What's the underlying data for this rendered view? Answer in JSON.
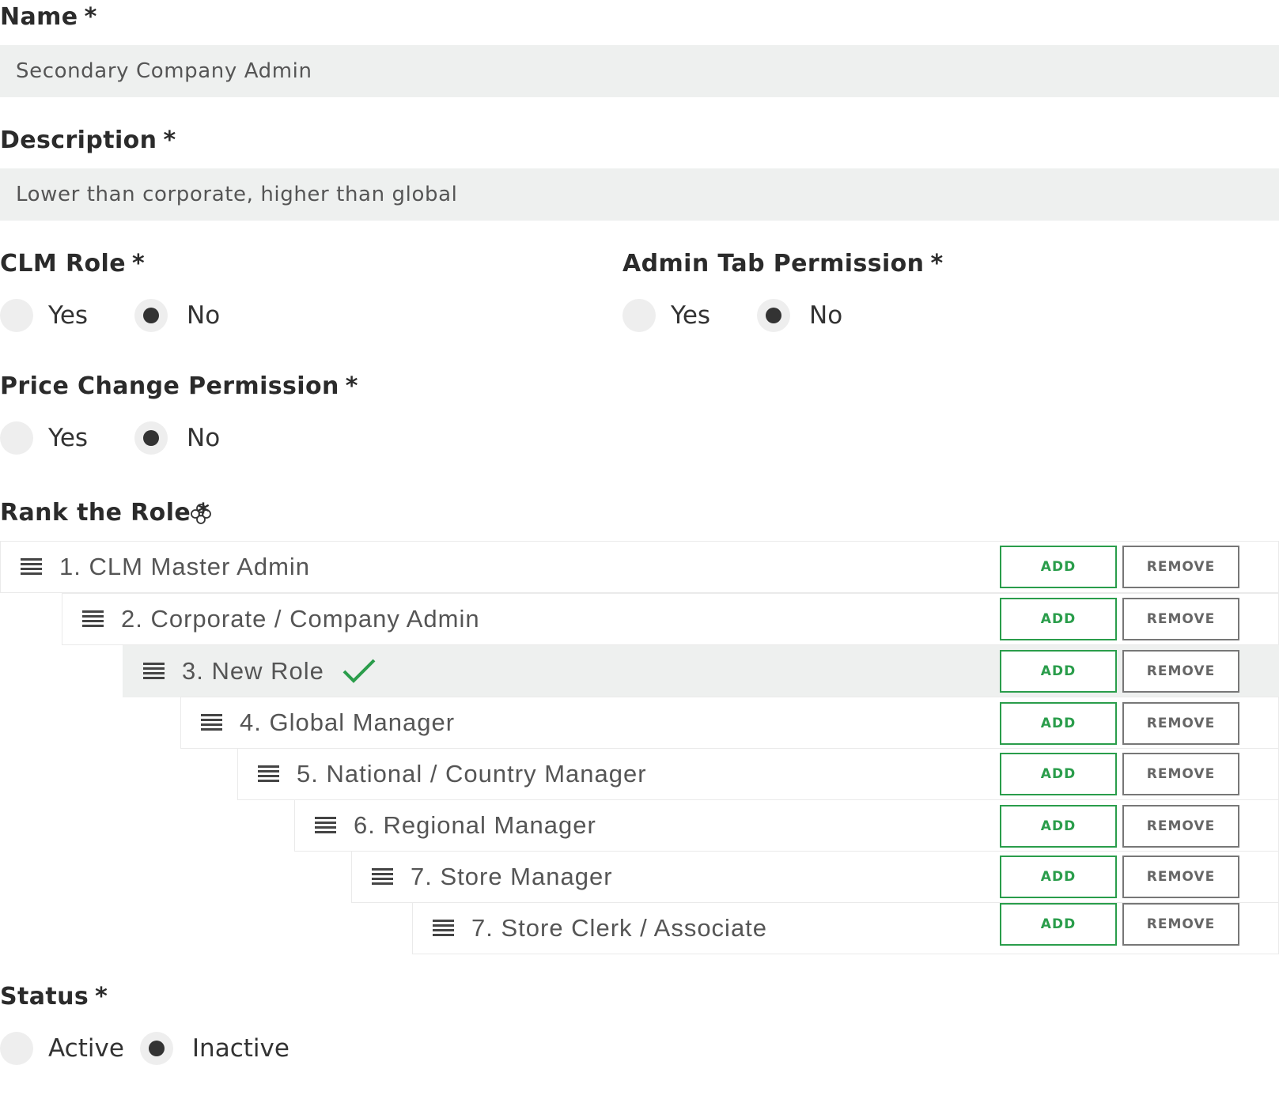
{
  "name_field": {
    "label": "Name",
    "required": "*",
    "value": "Secondary Company Admin"
  },
  "description_field": {
    "label": "Description",
    "required": "*",
    "value": "Lower than corporate, higher than global"
  },
  "clm_role": {
    "label": "CLM Role",
    "required": "*",
    "options": [
      "Yes",
      "No"
    ],
    "selected": "No"
  },
  "admin_tab_permission": {
    "label": "Admin Tab Permission",
    "required": "*",
    "options": [
      "Yes",
      "No"
    ],
    "selected": "No"
  },
  "price_change_permission": {
    "label": "Price Change Permission",
    "required": "*",
    "options": [
      "Yes",
      "No"
    ],
    "selected": "No"
  },
  "rank": {
    "label": "Rank the Role",
    "required": "*",
    "icon": "gear-flower-icon",
    "add_label": "ADD",
    "remove_label": "REMOVE",
    "accent_color": "#2a9d4b",
    "items": [
      {
        "label": "1. CLM Master Admin"
      },
      {
        "label": "2. Corporate / Company Admin"
      },
      {
        "label": "3. New Role",
        "current": true
      },
      {
        "label": "4. Global Manager"
      },
      {
        "label": "5. National / Country Manager"
      },
      {
        "label": "6. Regional Manager"
      },
      {
        "label": "7. Store Manager"
      },
      {
        "label": "7. Store Clerk / Associate"
      }
    ]
  },
  "status": {
    "label": "Status",
    "required": "*",
    "options": [
      "Active",
      "Inactive"
    ],
    "selected": "Inactive"
  }
}
